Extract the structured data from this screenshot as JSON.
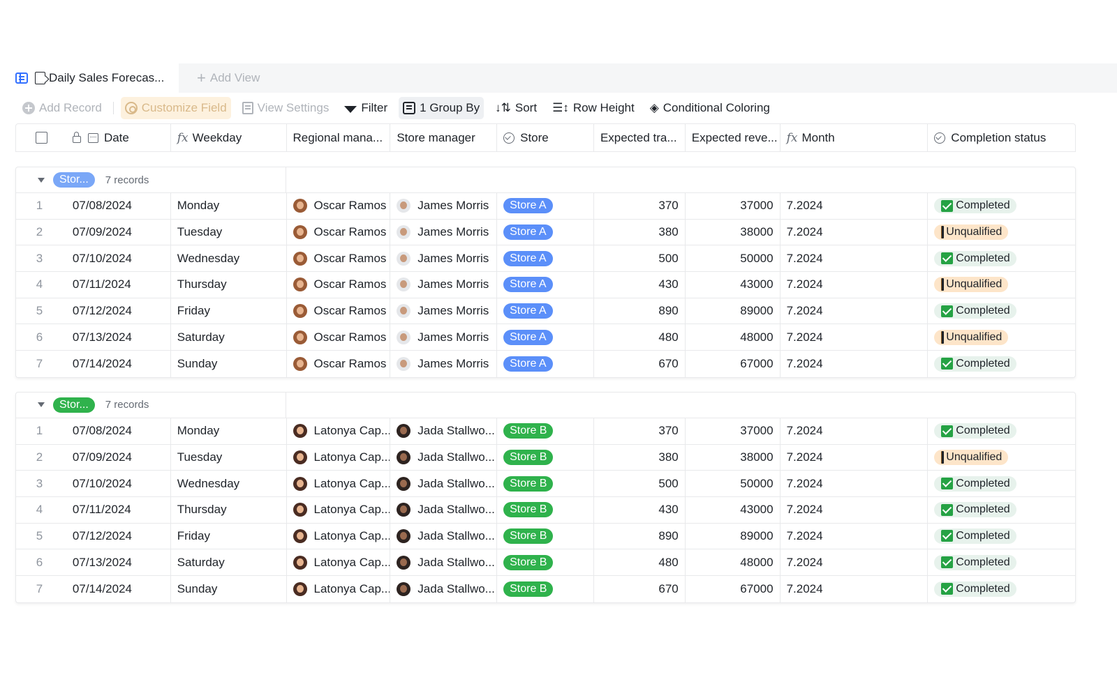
{
  "tabs": {
    "active_title": "Daily Sales Forecas...",
    "add_view": "Add View"
  },
  "toolbar": {
    "add_record": "Add Record",
    "customize_field": "Customize Field",
    "view_settings": "View Settings",
    "filter": "Filter",
    "group_by": "1 Group By",
    "sort": "Sort",
    "row_height": "Row Height",
    "conditional_coloring": "Conditional Coloring"
  },
  "columns": {
    "date": "Date",
    "weekday": "Weekday",
    "regional_manager": "Regional mana...",
    "store_manager": "Store manager",
    "store": "Store",
    "expected_traffic": "Expected tra...",
    "expected_revenue": "Expected reve...",
    "month": "Month",
    "completion_status": "Completion status"
  },
  "colors": {
    "store_a": "#5b8ff9",
    "store_b": "#2fb24c",
    "completed_bg": "#e7f2ec",
    "unqualified_bg": "#fde5c9"
  },
  "groups": [
    {
      "label": "Stor...",
      "count": "7 records",
      "color": "#7aa7f7",
      "rows": [
        {
          "idx": "1",
          "date": "07/08/2024",
          "weekday": "Monday",
          "regional": "Oscar Ramos",
          "manager": "James Morris",
          "store": "Store A",
          "traffic": "370",
          "revenue": "37000",
          "month": "7.2024",
          "status": "Completed"
        },
        {
          "idx": "2",
          "date": "07/09/2024",
          "weekday": "Tuesday",
          "regional": "Oscar Ramos",
          "manager": "James Morris",
          "store": "Store A",
          "traffic": "380",
          "revenue": "38000",
          "month": "7.2024",
          "status": "Unqualified"
        },
        {
          "idx": "3",
          "date": "07/10/2024",
          "weekday": "Wednesday",
          "regional": "Oscar Ramos",
          "manager": "James Morris",
          "store": "Store A",
          "traffic": "500",
          "revenue": "50000",
          "month": "7.2024",
          "status": "Completed"
        },
        {
          "idx": "4",
          "date": "07/11/2024",
          "weekday": "Thursday",
          "regional": "Oscar Ramos",
          "manager": "James Morris",
          "store": "Store A",
          "traffic": "430",
          "revenue": "43000",
          "month": "7.2024",
          "status": "Unqualified"
        },
        {
          "idx": "5",
          "date": "07/12/2024",
          "weekday": "Friday",
          "regional": "Oscar Ramos",
          "manager": "James Morris",
          "store": "Store A",
          "traffic": "890",
          "revenue": "89000",
          "month": "7.2024",
          "status": "Completed"
        },
        {
          "idx": "6",
          "date": "07/13/2024",
          "weekday": "Saturday",
          "regional": "Oscar Ramos",
          "manager": "James Morris",
          "store": "Store A",
          "traffic": "480",
          "revenue": "48000",
          "month": "7.2024",
          "status": "Unqualified"
        },
        {
          "idx": "7",
          "date": "07/14/2024",
          "weekday": "Sunday",
          "regional": "Oscar Ramos",
          "manager": "James Morris",
          "store": "Store A",
          "traffic": "670",
          "revenue": "67000",
          "month": "7.2024",
          "status": "Completed"
        }
      ]
    },
    {
      "label": "Stor...",
      "count": "7 records",
      "color": "#2fb24c",
      "rows": [
        {
          "idx": "1",
          "date": "07/08/2024",
          "weekday": "Monday",
          "regional": "Latonya Cap...",
          "manager": "Jada Stallwo...",
          "store": "Store B",
          "traffic": "370",
          "revenue": "37000",
          "month": "7.2024",
          "status": "Completed"
        },
        {
          "idx": "2",
          "date": "07/09/2024",
          "weekday": "Tuesday",
          "regional": "Latonya Cap...",
          "manager": "Jada Stallwo...",
          "store": "Store B",
          "traffic": "380",
          "revenue": "38000",
          "month": "7.2024",
          "status": "Unqualified"
        },
        {
          "idx": "3",
          "date": "07/10/2024",
          "weekday": "Wednesday",
          "regional": "Latonya Cap...",
          "manager": "Jada Stallwo...",
          "store": "Store B",
          "traffic": "500",
          "revenue": "50000",
          "month": "7.2024",
          "status": "Completed"
        },
        {
          "idx": "4",
          "date": "07/11/2024",
          "weekday": "Thursday",
          "regional": "Latonya Cap...",
          "manager": "Jada Stallwo...",
          "store": "Store B",
          "traffic": "430",
          "revenue": "43000",
          "month": "7.2024",
          "status": "Completed"
        },
        {
          "idx": "5",
          "date": "07/12/2024",
          "weekday": "Friday",
          "regional": "Latonya Cap...",
          "manager": "Jada Stallwo...",
          "store": "Store B",
          "traffic": "890",
          "revenue": "89000",
          "month": "7.2024",
          "status": "Completed"
        },
        {
          "idx": "6",
          "date": "07/13/2024",
          "weekday": "Saturday",
          "regional": "Latonya Cap...",
          "manager": "Jada Stallwo...",
          "store": "Store B",
          "traffic": "480",
          "revenue": "48000",
          "month": "7.2024",
          "status": "Completed"
        },
        {
          "idx": "7",
          "date": "07/14/2024",
          "weekday": "Sunday",
          "regional": "Latonya Cap...",
          "manager": "Jada Stallwo...",
          "store": "Store B",
          "traffic": "670",
          "revenue": "67000",
          "month": "7.2024",
          "status": "Completed"
        }
      ]
    }
  ]
}
